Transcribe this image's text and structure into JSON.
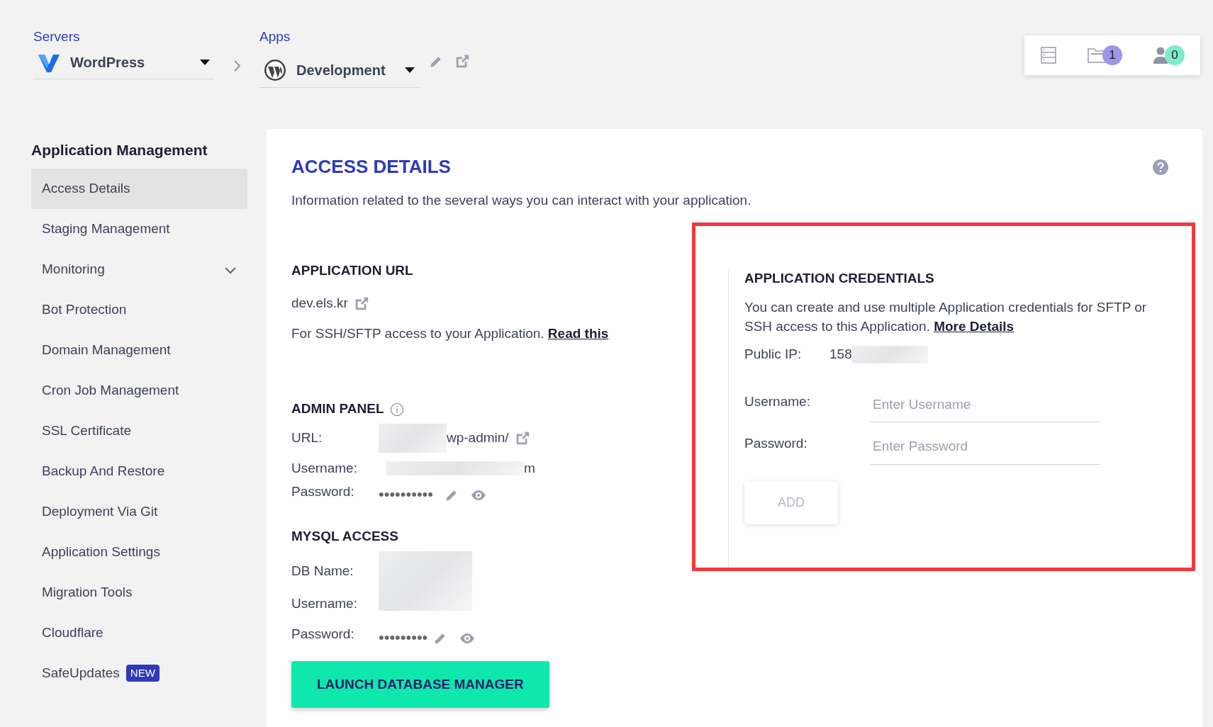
{
  "breadcrumb": [
    {
      "label": "Servers",
      "value": "WordPress",
      "kind": "server"
    },
    {
      "label": "Apps",
      "value": "Development",
      "kind": "app"
    }
  ],
  "header_icons": [
    {
      "kind": "servers"
    },
    {
      "kind": "folder",
      "count": "1",
      "color": "#9d95e6"
    },
    {
      "kind": "user",
      "count": "0",
      "color": "#7eebc9"
    }
  ],
  "sidebar": {
    "title": "Application Management",
    "items": [
      {
        "label": "Access Details",
        "selected": true
      },
      {
        "label": "Staging Management",
        "selected": false
      },
      {
        "label": "Monitoring",
        "selected": false,
        "expandable": true
      },
      {
        "label": "Bot Protection",
        "selected": false
      },
      {
        "label": "Domain Management",
        "selected": false
      },
      {
        "label": "Cron Job Management",
        "selected": false
      },
      {
        "label": "SSL Certificate",
        "selected": false
      },
      {
        "label": "Backup And Restore",
        "selected": false
      },
      {
        "label": "Deployment Via Git",
        "selected": false
      },
      {
        "label": "Application Settings",
        "selected": false
      },
      {
        "label": "Migration Tools",
        "selected": false
      },
      {
        "label": "Cloudflare",
        "selected": false
      },
      {
        "label": "SafeUpdates",
        "selected": false,
        "badge": "NEW"
      }
    ]
  },
  "page": {
    "title": "ACCESS DETAILS",
    "subtitle": "Information related to the several ways you can interact with your application."
  },
  "application_url": {
    "heading": "APPLICATION URL",
    "url": "dev.els.kr",
    "note": "For SSH/SFTP access to your Application.",
    "link": "Read this"
  },
  "admin_panel": {
    "heading": "ADMIN PANEL",
    "url_label": "URL:",
    "url_tail": "wp-admin/",
    "username_label": "Username:",
    "username_tail": "m",
    "password_label": "Password:",
    "password": "••••••••••"
  },
  "mysql": {
    "heading": "MYSQL ACCESS",
    "db_label": "DB Name:",
    "username_label": "Username:",
    "password_label": "Password:",
    "password": "•••••••••",
    "button": "LAUNCH DATABASE MANAGER"
  },
  "credentials": {
    "highlighted": true,
    "heading": "APPLICATION CREDENTIALS",
    "text": "You can create and use multiple Application credentials for SFTP or SSH access to this Application.",
    "link": "More Details",
    "ip_label": "Public IP:",
    "ip": "158",
    "username_label": "Username:",
    "username_placeholder": "Enter Username",
    "password_label": "Password:",
    "password_placeholder": "Enter Password",
    "button": "ADD",
    "button_disabled": true
  }
}
